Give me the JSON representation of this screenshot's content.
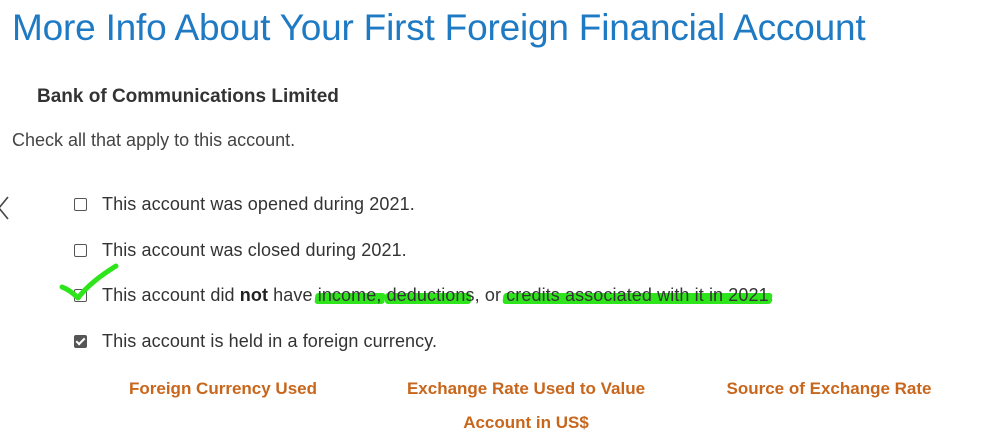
{
  "header": {
    "title": "More Info About Your First Foreign Financial Account"
  },
  "account": {
    "bank_name": "Bank of Communications Limited"
  },
  "instructions": {
    "text": "Check all that apply to this account."
  },
  "options": [
    {
      "label": "This account was opened during 2021.",
      "checked": false
    },
    {
      "label": "This account was closed during 2021.",
      "checked": false
    },
    {
      "label_parts": {
        "a": "This account did ",
        "b": "not",
        "c": " have ",
        "d": "income,",
        "e": " ",
        "f": "deductions",
        "g": ", or ",
        "h": "credits associated with it in 2021",
        "i": "."
      },
      "checked": false
    },
    {
      "label": "This account is held in a foreign currency.",
      "checked": true
    }
  ],
  "columns": {
    "currency": "Foreign Currency Used",
    "rate_line1": "Exchange Rate Used to Value",
    "rate_line2": "Account in US$",
    "source": "Source of Exchange Rate"
  },
  "colors": {
    "title": "#1f7ac4",
    "column_header": "#c8661c",
    "highlight": "#2ee51b"
  },
  "icons": {
    "back": "chevron-left-icon",
    "annotation": "green-checkmark-annotation"
  }
}
